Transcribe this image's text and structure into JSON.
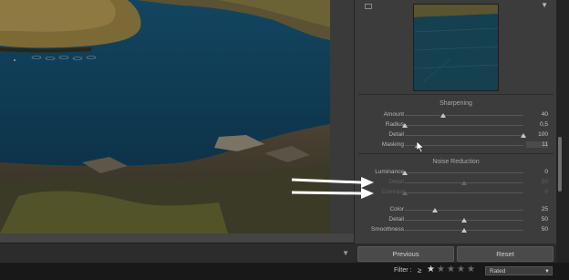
{
  "panel": {
    "sharpening": {
      "title": "Sharpening",
      "sliders": [
        {
          "label": "Amount",
          "value": "40",
          "level": 0.32
        },
        {
          "label": "Radius",
          "value": "0,5",
          "level": 0.0
        },
        {
          "label": "Detail",
          "value": "100",
          "level": 1.0
        },
        {
          "label": "Masking",
          "value": "11",
          "level": 0.11
        }
      ]
    },
    "noise_reduction": {
      "title": "Noise Reduction",
      "sliders": [
        {
          "label": "Luminance",
          "value": "0",
          "level": 0.0
        },
        {
          "label": "Detail",
          "value": "50",
          "level": 0.5
        },
        {
          "label": "Contrast",
          "value": "0",
          "level": 0.0
        },
        {
          "label": "Color",
          "value": "25",
          "level": 0.25
        },
        {
          "label": "Detail",
          "value": "50",
          "level": 0.5
        },
        {
          "label": "Smoothness",
          "value": "50",
          "level": 0.5
        }
      ]
    }
  },
  "buttons": {
    "previous": "Previous",
    "reset": "Reset"
  },
  "filter": {
    "label": "Filter :",
    "operator": "≥",
    "rating": 1,
    "max_rating": 5,
    "mode": "Rated"
  },
  "icons": {
    "histogram": "histogram-toggle-icon",
    "panel_menu": "panel-collapse-icon",
    "filmstrip": "filmstrip-toggle-icon",
    "cursor": "mouse-cursor-icon"
  },
  "colors": {
    "annotation_arrows": "#ffffff",
    "panel_bg": "#3c3c3c",
    "photo_water": "#0f3a52"
  }
}
